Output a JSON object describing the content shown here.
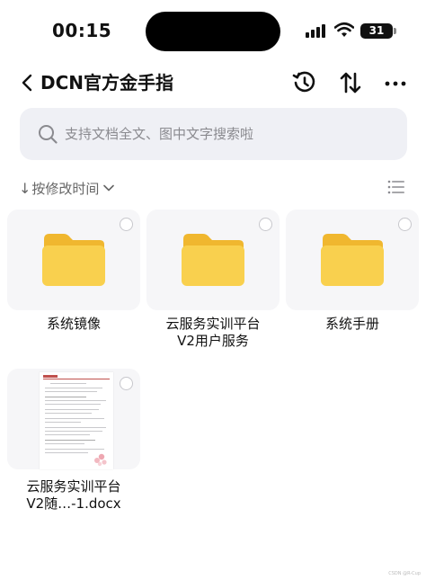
{
  "status_bar": {
    "time": "00:15",
    "battery": "31"
  },
  "nav": {
    "title": "DCN官方金手指"
  },
  "search": {
    "placeholder": "支持文档全文、图中文字搜索啦",
    "value": ""
  },
  "sort": {
    "label": "按修改时间"
  },
  "items": [
    {
      "name": "系统镜像",
      "kind": "folder"
    },
    {
      "name": "云服务实训平台\nV2用户服务",
      "kind": "folder"
    },
    {
      "name": "系统手册",
      "kind": "folder"
    },
    {
      "name": "云服务实训平台\nV2随…-1.docx",
      "kind": "docx"
    }
  ],
  "colors": {
    "folder_body": "#f9d04e",
    "folder_tab": "#f0b72f",
    "accent_text": "#111111",
    "muted": "#8a8a8f"
  },
  "icons": [
    "back-icon",
    "history-icon",
    "sort-swap-icon",
    "more-icon",
    "search-icon",
    "chevron-down-icon",
    "list-view-icon",
    "folder-icon"
  ],
  "watermark": "CSDN @R-Cup"
}
